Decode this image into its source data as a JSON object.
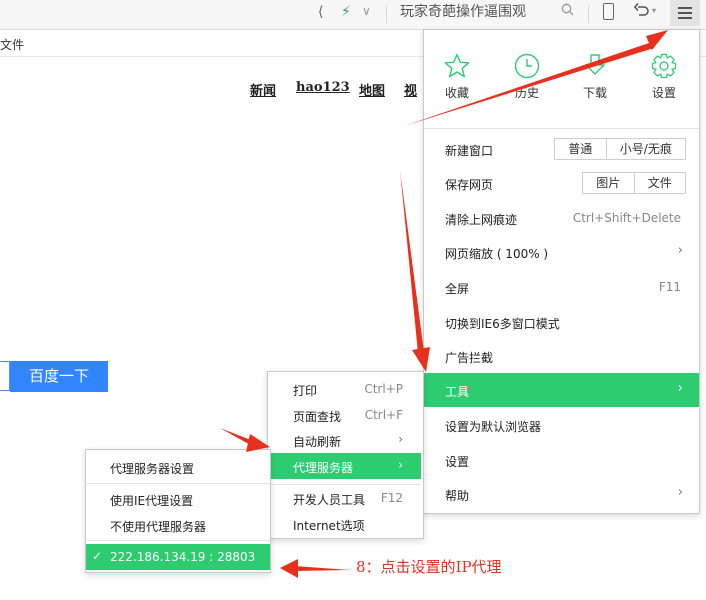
{
  "toolbar": {
    "search_text": "玩家奇葩操作逼围观",
    "icons": [
      "share-icon",
      "bolt-icon",
      "chevron-down-icon",
      "search-icon",
      "phone-icon",
      "undo-icon",
      "menu-icon"
    ]
  },
  "bookmarks": {
    "item": "文件"
  },
  "page": {
    "links": [
      "新闻",
      "hao123",
      "地图",
      "视"
    ],
    "search_button": "百度一下"
  },
  "main_menu": {
    "tiles": [
      {
        "label": "收藏",
        "icon": "star-icon"
      },
      {
        "label": "历史",
        "icon": "clock-icon"
      },
      {
        "label": "下载",
        "icon": "download-icon"
      },
      {
        "label": "设置",
        "icon": "gear-icon"
      }
    ],
    "items": {
      "new_window": {
        "label": "新建窗口",
        "options": [
          "普通",
          "小号/无痕"
        ]
      },
      "save_page": {
        "label": "保存网页",
        "options": [
          "图片",
          "文件"
        ]
      },
      "clear_traces": {
        "label": "清除上网痕迹",
        "shortcut": "Ctrl+Shift+Delete"
      },
      "zoom": {
        "label": "网页缩放 ( 100% )"
      },
      "fullscreen": {
        "label": "全屏",
        "shortcut": "F11"
      },
      "ie6_mode": {
        "label": "切换到IE6多窗口模式"
      },
      "adblock": {
        "label": "广告拦截"
      },
      "tools": {
        "label": "工具"
      },
      "default_browser": {
        "label": "设置为默认浏览器"
      },
      "settings": {
        "label": "设置"
      },
      "help": {
        "label": "帮助"
      }
    }
  },
  "tools_menu": {
    "print": {
      "label": "打印",
      "shortcut": "Ctrl+P"
    },
    "find": {
      "label": "页面查找",
      "shortcut": "Ctrl+F"
    },
    "auto_refresh": {
      "label": "自动刷新"
    },
    "proxy": {
      "label": "代理服务器"
    },
    "devtools": {
      "label": "开发人员工具",
      "shortcut": "F12"
    },
    "internet_options": {
      "label": "Internet选项"
    }
  },
  "proxy_menu": {
    "settings": {
      "label": "代理服务器设置"
    },
    "use_ie": {
      "label": "使用IE代理设置"
    },
    "no_proxy": {
      "label": "不使用代理服务器"
    },
    "selected": {
      "label": "222.186.134.19 : 28803"
    }
  },
  "annotation": {
    "text": "8：点击设置的IP代理"
  },
  "colors": {
    "accent_green": "#2ecc71",
    "baidu_blue": "#3385ff",
    "arrow_red": "#e8301f"
  }
}
